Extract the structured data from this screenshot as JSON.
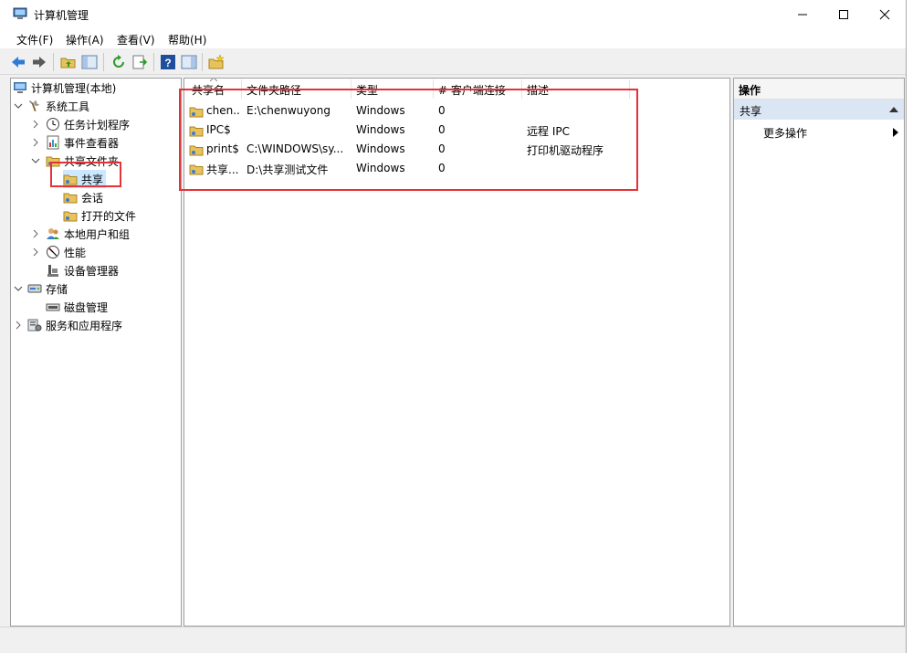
{
  "window": {
    "title": "计算机管理"
  },
  "menu": {
    "items": [
      "文件(F)",
      "操作(A)",
      "查看(V)",
      "帮助(H)"
    ]
  },
  "tree": {
    "root": "计算机管理(本地)",
    "system_tools": "系统工具",
    "task_scheduler": "任务计划程序",
    "event_viewer": "事件查看器",
    "shared_folders": "共享文件夹",
    "shares": "共享",
    "sessions": "会话",
    "open_files": "打开的文件",
    "local_users": "本地用户和组",
    "performance": "性能",
    "device_manager": "设备管理器",
    "storage": "存储",
    "disk_management": "磁盘管理",
    "services_apps": "服务和应用程序"
  },
  "table": {
    "headers": [
      "共享名",
      "文件夹路径",
      "类型",
      "# 客户端连接",
      "描述"
    ],
    "rows": [
      [
        "chen...",
        "E:\\chenwuyong",
        "Windows",
        "0",
        ""
      ],
      [
        "IPC$",
        "",
        "Windows",
        "0",
        "远程 IPC"
      ],
      [
        "print$",
        "C:\\WINDOWS\\sy...",
        "Windows",
        "0",
        "打印机驱动程序"
      ],
      [
        "共享...",
        "D:\\共享测试文件",
        "Windows",
        "0",
        ""
      ]
    ]
  },
  "actions": {
    "header": "操作",
    "section": "共享",
    "more": "更多操作"
  },
  "colors": {
    "accent": "#cce8ff",
    "highlight_box": "#e53238",
    "selected_section": "#dbe6f4"
  }
}
